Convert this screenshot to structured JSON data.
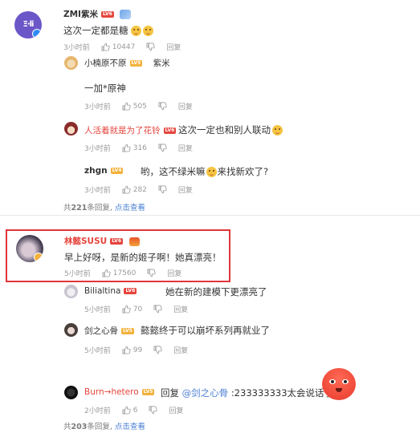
{
  "colors": {
    "accent_red": "#e5453d",
    "highlight_border": "#e0353a",
    "link_blue": "#4a7fd3",
    "meta_gray": "#9a9a9a"
  },
  "thread1": {
    "author": "ZMI紫米",
    "text": "这次一定都是糖",
    "time": "3小时前",
    "likes": "10447",
    "reply_label": "回复",
    "replies": [
      {
        "author": "小楠原不原",
        "mention": "紫米",
        "text": "一加*原神",
        "time": "3小时前",
        "likes": "505",
        "reply_label": "回复"
      },
      {
        "author": "人活着就是为了花铃",
        "text": "这次一定也和别人联动",
        "time": "3小时前",
        "likes": "316",
        "reply_label": "回复"
      },
      {
        "author": "zhgn",
        "text": "哟，这不绿米嘛",
        "text2": "来找新欢了?",
        "time": "3小时前",
        "likes": "282",
        "reply_label": "回复"
      }
    ],
    "total_prefix": "共",
    "total_count": "221",
    "total_suffix": "条回复,",
    "view_label": "点击查看"
  },
  "thread2": {
    "author": "林懿SUSU",
    "text": "早上好呀，是新的姬子啊！她真漂亮！",
    "time": "5小时前",
    "likes": "17560",
    "reply_label": "回复",
    "replies": [
      {
        "author": "Bilialtina",
        "text": "她在新的建模下更漂亮了",
        "time": "5小时前",
        "likes": "70",
        "reply_label": "回复"
      },
      {
        "author": "剑之心骨",
        "text": "懿懿终于可以崩坏系列再就业了",
        "time": "5小时前",
        "likes": "99",
        "reply_label": "回复"
      },
      {
        "author": "Burn→hetero",
        "reply_prefix": "回复",
        "mention": "@剑之心骨",
        "text": ":233333333太会说话了",
        "time": "2小时前",
        "likes": "6",
        "reply_label": "回复"
      }
    ],
    "total_prefix": "共",
    "total_count": "203",
    "total_suffix": "条回复,",
    "view_label": "点击查看"
  },
  "icons": [
    "like-icon",
    "dislike-icon",
    "level-badge",
    "emoji-icon"
  ]
}
